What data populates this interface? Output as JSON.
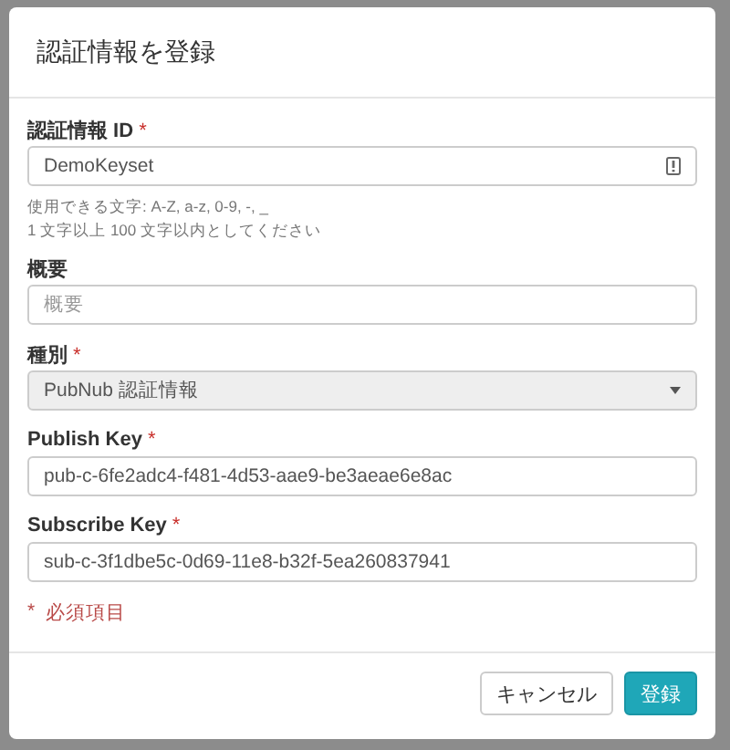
{
  "dialog": {
    "title": "認証情報を登録"
  },
  "fields": [
    {
      "kind": "text",
      "label": "認証情報 ID",
      "required": true,
      "value": "DemoKeyset",
      "icon": true,
      "help": [
        "使用できる文字: A-Z, a-z, 0-9, -, _",
        "1 文字以上 100 文字以内としてください"
      ]
    },
    {
      "kind": "text",
      "label": "概要",
      "required": false,
      "placeholder": "概要"
    },
    {
      "kind": "select",
      "label": "種別",
      "required": true,
      "value": "PubNub 認証情報",
      "disabled": true
    },
    {
      "kind": "text",
      "label": "Publish Key",
      "required": true,
      "value": "pub-c-6fe2adc4-f481-4d53-aae9-be3aeae6e8ac"
    },
    {
      "kind": "text",
      "label": "Subscribe Key",
      "required": true,
      "value": "sub-c-3f1dbe5c-0d69-11e8-b32f-5ea260837941"
    }
  ],
  "required_note": {
    "mark": "*",
    "text": "必須項目"
  },
  "buttons": [
    {
      "label": "キャンセル",
      "kind": "default"
    },
    {
      "label": "登録",
      "kind": "primary"
    }
  ]
}
